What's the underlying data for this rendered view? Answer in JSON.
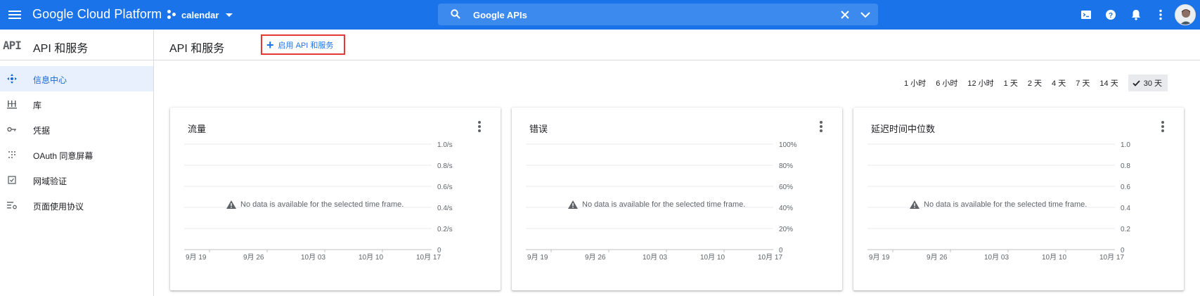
{
  "topbar": {
    "brand": "Google Cloud Platform",
    "project": "calendar",
    "search_value": "Google APIs",
    "icons": [
      "menu-icon",
      "project-icon",
      "search-icon",
      "clear-icon",
      "expand-icon",
      "cloud-shell-icon",
      "help-icon",
      "notifications-icon",
      "more-icon",
      "avatar"
    ]
  },
  "sidebar": {
    "logo": "API",
    "title": "API 和服务",
    "items": [
      {
        "label": "信息中心",
        "icon": "dashboard-icon",
        "active": true
      },
      {
        "label": "库",
        "icon": "library-icon"
      },
      {
        "label": "凭据",
        "icon": "key-icon"
      },
      {
        "label": "OAuth 同意屏幕",
        "icon": "oauth-icon"
      },
      {
        "label": "网域验证",
        "icon": "checkbox-icon"
      },
      {
        "label": "页面使用协议",
        "icon": "settings-list-icon"
      }
    ]
  },
  "header": {
    "title": "API 和服务",
    "enable_button": "启用 API 和服务"
  },
  "time_range": {
    "options": [
      "1 小时",
      "6 小时",
      "12 小时",
      "1 天",
      "2 天",
      "4 天",
      "7 天",
      "14 天",
      "30 天"
    ],
    "selected": "30 天"
  },
  "no_data_message": "No data is available for the selected time frame.",
  "colors": {
    "topbar": "#1a73e8",
    "accent": "#1967d2",
    "highlight_border": "#e53935",
    "active_bg": "#e8f0fe"
  },
  "chart_data": [
    {
      "type": "line",
      "title": "流量",
      "x": [
        "9月 19",
        "9月 26",
        "10月 03",
        "10月 10",
        "10月 17"
      ],
      "y_ticks": [
        "1.0/s",
        "0.8/s",
        "0.6/s",
        "0.4/s",
        "0.2/s",
        "0"
      ],
      "series": []
    },
    {
      "type": "line",
      "title": "错误",
      "x": [
        "9月 19",
        "9月 26",
        "10月 03",
        "10月 10",
        "10月 17"
      ],
      "y_ticks": [
        "100%",
        "80%",
        "60%",
        "40%",
        "20%",
        "0"
      ],
      "series": []
    },
    {
      "type": "line",
      "title": "延迟时间中位数",
      "x": [
        "9月 19",
        "9月 26",
        "10月 03",
        "10月 10",
        "10月 17"
      ],
      "y_ticks": [
        "1.0",
        "0.8",
        "0.6",
        "0.4",
        "0.2",
        "0"
      ],
      "series": []
    }
  ]
}
